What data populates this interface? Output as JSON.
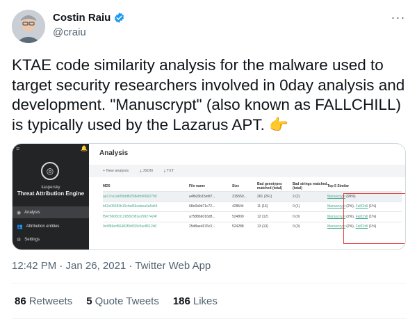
{
  "author": {
    "name": "Costin Raiu",
    "handle": "@craiu",
    "verified": true
  },
  "tweet": {
    "text": "KTAE code similarity analysis for the malware used to target security researchers involved in 0day analysis and development. \"Manuscrypt\" (also known as FALLCHILL) is typically used by the Lazarus APT. 👉"
  },
  "media": {
    "sidebar": {
      "brand": "kaspersky",
      "product": "Threat Attribution Engine",
      "nav": [
        {
          "label": "Analysis",
          "icon": "analysis-icon",
          "active": true
        },
        {
          "label": "Attribution entities",
          "icon": "entities-icon",
          "active": false
        },
        {
          "label": "Settings",
          "icon": "settings-icon",
          "active": false
        }
      ]
    },
    "main": {
      "title": "Analysis",
      "toolbar": {
        "new_analysis": "+ New analysis",
        "json": "JSON",
        "txt": "TXT"
      },
      "columns": {
        "md5": "MD5",
        "file": "File name",
        "size": "Size",
        "genotypes": "Bad genotypes matched (total)",
        "strings": "Bad strings matched (total)",
        "similar": "Top 5 Similar"
      },
      "rows": [
        {
          "md5": "ae17ce1eb59dd82f38efb96662790",
          "file": "a4fb20b15efd7...",
          "size": "315550...",
          "genotypes": "261 (261)",
          "strings": "2 (2)",
          "sim1": "Manuscrypt",
          "sim1_pct": "(99%)",
          "sim2": "",
          "sim2_pct": ""
        },
        {
          "md5": "b52e05683b15cfad56cebea4a5a54",
          "file": "68e6b9d71c72...",
          "size": "428544",
          "genotypes": "11 (16)",
          "strings": "0 (1)",
          "sim1": "Manuscrypt",
          "sim1_pct": "(2%),",
          "sim2": "FallChill",
          "sim2_pct": "(1%)"
        },
        {
          "md5": "f5475608c0126582081e29927424f",
          "file": "a75886b016d8...",
          "size": "524800",
          "genotypes": "12 (12)",
          "strings": "0 (0)",
          "sim1": "Manuscrypt",
          "sim1_pct": "(2%),",
          "sim2": "FallChill",
          "sim2_pct": "(1%)"
        },
        {
          "md5": "9e9f69ed56482f0d933c5ec8612d0",
          "file": "25d8ae4676c3...",
          "size": "524288",
          "genotypes": "13 (13)",
          "strings": "0 (0)",
          "sim1": "Manuscrypt",
          "sim1_pct": "(2%),",
          "sim2": "FallChill",
          "sim2_pct": "(1%)"
        }
      ]
    }
  },
  "meta": {
    "timestamp": "12:42 PM · Jan 26, 2021 · Twitter Web App"
  },
  "stats": {
    "retweets_count": "86",
    "retweets_label": "Retweets",
    "quotes_count": "5",
    "quotes_label": "Quote Tweets",
    "likes_count": "186",
    "likes_label": "Likes"
  },
  "colors": {
    "verified": "#1d9bf0",
    "muted": "#536471",
    "link_green": "#46a88e",
    "highlight_red": "#e23c3c"
  }
}
